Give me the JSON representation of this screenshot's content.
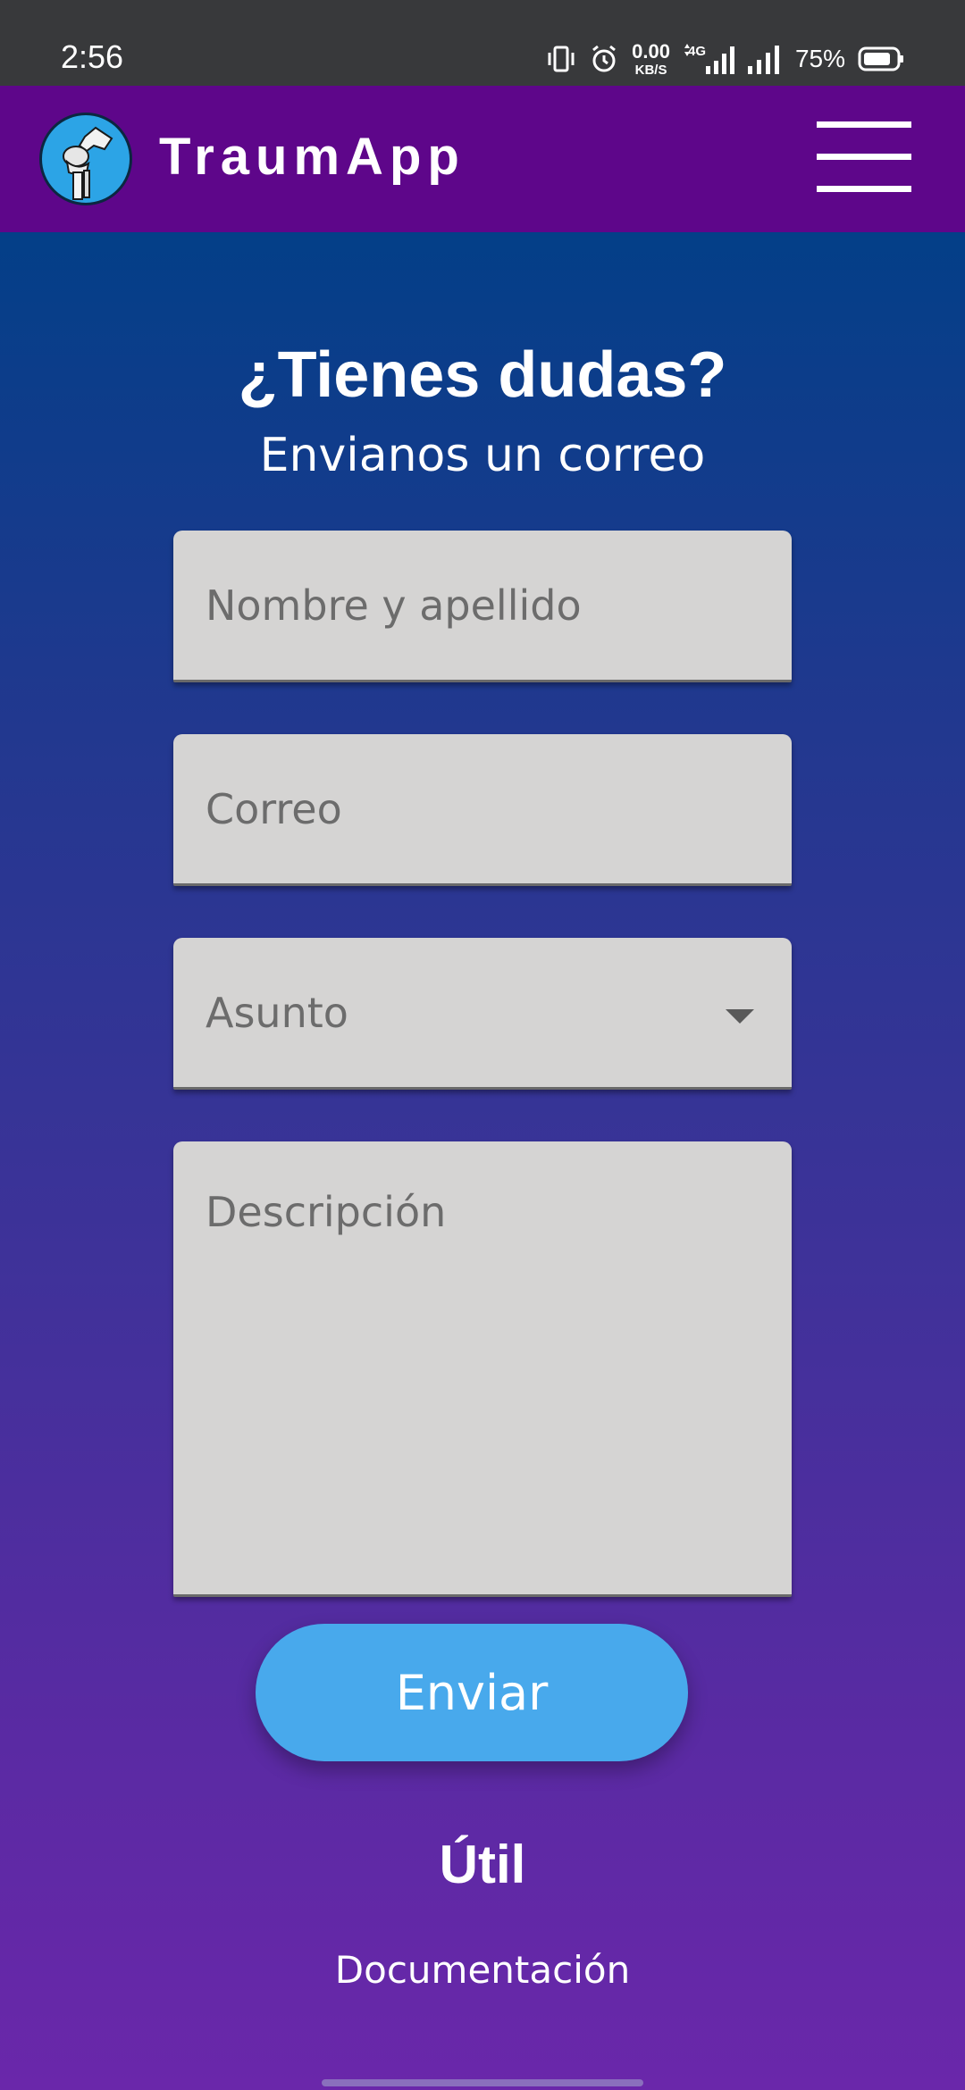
{
  "status_bar": {
    "time": "2:56",
    "net_speed_value": "0.00",
    "net_speed_unit": "KB/S",
    "network_type": "4G",
    "battery_percent": "75%",
    "icons": [
      "vibrate-icon",
      "alarm-icon",
      "network-speed",
      "4g-signal-icon",
      "signal-icon",
      "battery-icon"
    ]
  },
  "app_bar": {
    "title": "TraumApp",
    "logo": "knee-joint-logo",
    "menu_icon": "hamburger-menu-icon",
    "background_color": "#5e068a"
  },
  "form": {
    "heading": "¿Tienes dudas?",
    "subheading": "Envianos un correo",
    "name_placeholder": "Nombre y apellido",
    "email_placeholder": "Correo",
    "subject_value": "Asunto",
    "description_placeholder": "Descripción",
    "submit_label": "Enviar",
    "field_color": "#d5d4d3",
    "button_color": "#48a9ec"
  },
  "footer": {
    "title": "Útil",
    "link": "Documentación"
  }
}
